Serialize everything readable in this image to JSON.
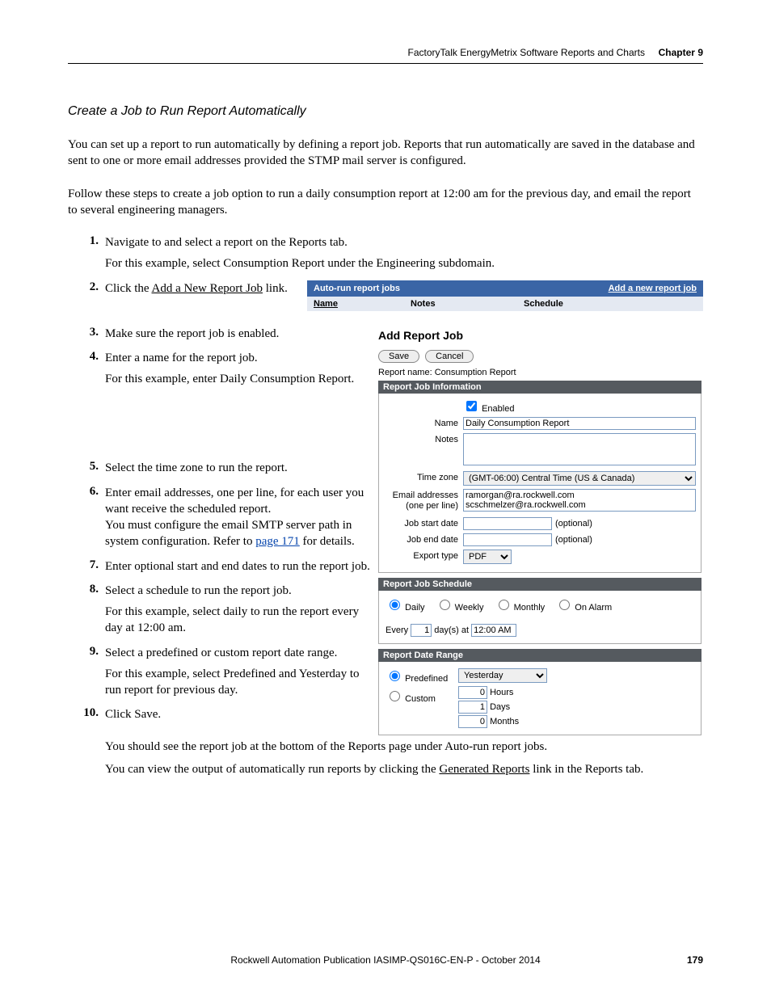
{
  "header": {
    "left": "FactoryTalk EnergyMetrix Software Reports and Charts",
    "right_label": "Chapter 9"
  },
  "section_title": "Create a Job to Run Report Automatically",
  "intro1": "You can set up a report to run automatically by defining a report job. Reports that run automatically are saved in the database and sent to one or more email addresses provided the STMP mail server is configured.",
  "intro2": "Follow these steps to create a job option to run a daily consumption report at 12:00 am for the previous day, and email the report to several engineering managers.",
  "steps": {
    "s1": "Navigate to and select a report on the Reports tab.",
    "s1b": "For this example, select Consumption Report under the Engineering subdomain.",
    "s2a": "Click the ",
    "s2link": "Add a New Report Job",
    "s2b": " link.",
    "s3": "Make sure the report job is enabled.",
    "s4": "Enter a name for the report job.",
    "s4b": "For this example, enter Daily Consumption Report.",
    "s5": "Select the time zone to run the report.",
    "s6a": "Enter email addresses, one per line, for each user you want receive the scheduled report.",
    "s6b": "You must configure the email SMTP server path in system configuration. Refer to ",
    "s6link": "page 171",
    "s6c": " for details.",
    "s7": "Enter optional start and end dates to run the report job.",
    "s8": "Select a schedule to run the report job.",
    "s8b": "For this example, select daily to run the report every day at 12:00 am.",
    "s9": "Select a predefined or custom report date range.",
    "s9b": "For this example, select Predefined and Yesterday to run report for previous day.",
    "s10": "Click Save.",
    "s10b": "You should see the report job at the bottom of the Reports page under Auto-run report jobs.",
    "s10c_a": "You can view the output of automatically run reports by clicking the ",
    "s10c_link": "Generated Reports",
    "s10c_b": " link in the Reports tab."
  },
  "ss1": {
    "title": "Auto-run report jobs",
    "add_link": "Add a new report job",
    "col_name": "Name",
    "col_notes": "Notes",
    "col_schedule": "Schedule"
  },
  "ss2": {
    "heading": "Add Report Job",
    "save": "Save",
    "cancel": "Cancel",
    "report_name_label": "Report name:",
    "report_name_value": "Consumption Report",
    "section_info": "Report Job Information",
    "enabled": "Enabled",
    "name_label": "Name",
    "name_value": "Daily Consumption Report",
    "notes_label": "Notes",
    "notes_value": "",
    "tz_label": "Time zone",
    "tz_value": "(GMT-06:00) Central Time (US & Canada)",
    "email_label": "Email addresses (one per line)",
    "email_value": "ramorgan@ra.rockwell.com\nscschmelzer@ra.rockwell.com",
    "start_label": "Job start date",
    "end_label": "Job end date",
    "optional": "(optional)",
    "export_label": "Export type",
    "export_value": "PDF",
    "section_sched": "Report Job Schedule",
    "r_daily": "Daily",
    "r_weekly": "Weekly",
    "r_monthly": "Monthly",
    "r_alarm": "On Alarm",
    "every": "Every",
    "every_val": "1",
    "days_at": "day(s) at",
    "time_val": "12:00 AM",
    "section_range": "Report Date Range",
    "r_predef": "Predefined",
    "r_custom": "Custom",
    "predef_val": "Yesterday",
    "hours_val": "0",
    "hours": "Hours",
    "days_val": "1",
    "days": "Days",
    "months_val": "0",
    "months": "Months"
  },
  "footer": {
    "pub": "Rockwell Automation Publication IASIMP-QS016C-EN-P - October 2014",
    "page": "179"
  }
}
